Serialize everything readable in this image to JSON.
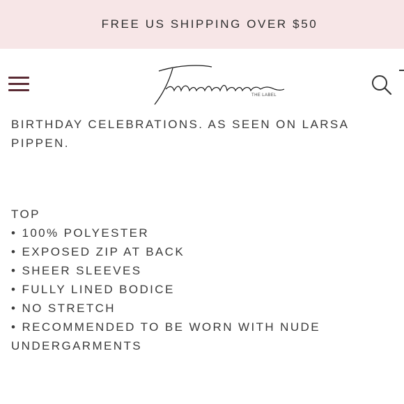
{
  "promo": {
    "text": "FREE US SHIPPING OVER $50"
  },
  "header": {
    "logo_text": "Twosisters",
    "logo_subtext": "THE LABEL",
    "menu_icon": "hamburger-menu-icon",
    "search_icon": "search-icon"
  },
  "description": {
    "intro": "BIRTHDAY CELEBRATIONS. AS SEEN ON LARSA PIPPEN.",
    "section_title": "TOP",
    "bullets": [
      "• 100% POLYESTER",
      "• EXPOSED ZIP AT BACK",
      "• SHEER SLEEVES",
      "• FULLY LINED BODICE",
      "• NO STRETCH",
      "• RECOMMENDED TO BE WORN WITH NUDE UNDERGARMENTS"
    ]
  },
  "colors": {
    "promo_background": "#f7e6e7",
    "menu_icon": "#5a2a33",
    "text": "#3a3a3a"
  }
}
